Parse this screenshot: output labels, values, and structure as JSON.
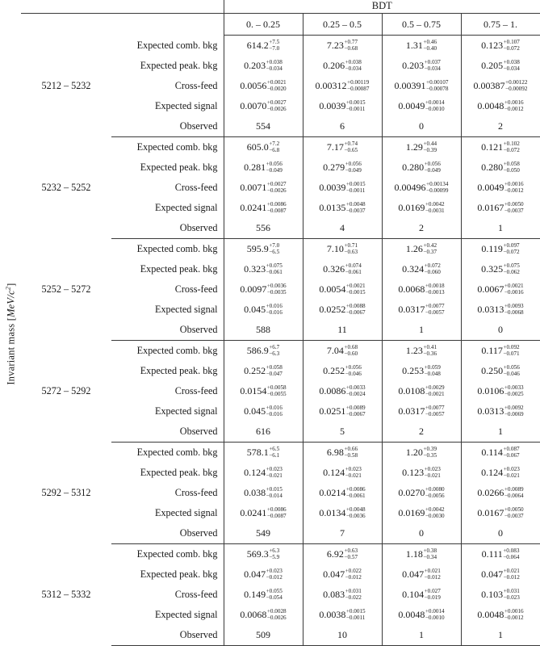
{
  "axis": {
    "ylabel_text": "Invariant mass",
    "ylabel_unit_open": "[",
    "ylabel_unit": "MeV/c",
    "ylabel_unit_sup": "2",
    "ylabel_unit_close": "]"
  },
  "header": {
    "group_label": "BDT",
    "bdt_bins": [
      "0. – 0.25",
      "0.25 – 0.5",
      "0.5 – 0.75",
      "0.75 – 1."
    ]
  },
  "row_labels": [
    "Expected comb. bkg",
    "Expected peak. bkg",
    "Cross-feed",
    "Expected signal",
    "Observed"
  ],
  "blocks": [
    {
      "bin": "5212 – 5232",
      "rows": [
        [
          {
            "v": "614.2",
            "up": "+7.5",
            "dn": "−7.0"
          },
          {
            "v": "7.23",
            "up": "+0.77",
            "dn": "−0.68"
          },
          {
            "v": "1.31",
            "up": "+0.46",
            "dn": "−0.40"
          },
          {
            "v": "0.123",
            "up": "+0.107",
            "dn": "−0.072"
          }
        ],
        [
          {
            "v": "0.203",
            "up": "+0.038",
            "dn": "−0.034"
          },
          {
            "v": "0.206",
            "up": "+0.038",
            "dn": "−0.034"
          },
          {
            "v": "0.203",
            "up": "+0.037",
            "dn": "−0.034"
          },
          {
            "v": "0.205",
            "up": "+0.038",
            "dn": "−0.034"
          }
        ],
        [
          {
            "v": "0.0056",
            "up": "+0.0021",
            "dn": "−0.0020"
          },
          {
            "v": "0.00312",
            "up": "+0.00119",
            "dn": "−0.00087"
          },
          {
            "v": "0.00391",
            "up": "+0.00107",
            "dn": "−0.00078"
          },
          {
            "v": "0.00387",
            "up": "+0.00122",
            "dn": "−0.00092"
          }
        ],
        [
          {
            "v": "0.0070",
            "up": "+0.0027",
            "dn": "−0.0026"
          },
          {
            "v": "0.0039",
            "up": "+0.0015",
            "dn": "−0.0011"
          },
          {
            "v": "0.0049",
            "up": "+0.0014",
            "dn": "−0.0010"
          },
          {
            "v": "0.0048",
            "up": "+0.0016",
            "dn": "−0.0012"
          }
        ],
        [
          {
            "v": "554",
            "up": "",
            "dn": ""
          },
          {
            "v": "6",
            "up": "",
            "dn": ""
          },
          {
            "v": "0",
            "up": "",
            "dn": ""
          },
          {
            "v": "2",
            "up": "",
            "dn": ""
          }
        ]
      ]
    },
    {
      "bin": "5232 – 5252",
      "rows": [
        [
          {
            "v": "605.0",
            "up": "+7.2",
            "dn": "−6.8"
          },
          {
            "v": "7.17",
            "up": "+0.74",
            "dn": "−0.65"
          },
          {
            "v": "1.29",
            "up": "+0.44",
            "dn": "−0.39"
          },
          {
            "v": "0.121",
            "up": "+0.102",
            "dn": "−0.072"
          }
        ],
        [
          {
            "v": "0.281",
            "up": "+0.056",
            "dn": "−0.049"
          },
          {
            "v": "0.279",
            "up": "+0.056",
            "dn": "−0.049"
          },
          {
            "v": "0.280",
            "up": "+0.056",
            "dn": "−0.049"
          },
          {
            "v": "0.280",
            "up": "+0.058",
            "dn": "−0.050"
          }
        ],
        [
          {
            "v": "0.0071",
            "up": "+0.0027",
            "dn": "−0.0026"
          },
          {
            "v": "0.0039",
            "up": "+0.0015",
            "dn": "−0.0011"
          },
          {
            "v": "0.00496",
            "up": "+0.00134",
            "dn": "−0.00099"
          },
          {
            "v": "0.0049",
            "up": "+0.0016",
            "dn": "−0.0012"
          }
        ],
        [
          {
            "v": "0.0241",
            "up": "+0.0086",
            "dn": "−0.0087"
          },
          {
            "v": "0.0135",
            "up": "+0.0048",
            "dn": "−0.0037"
          },
          {
            "v": "0.0169",
            "up": "+0.0042",
            "dn": "−0.0031"
          },
          {
            "v": "0.0167",
            "up": "+0.0050",
            "dn": "−0.0037"
          }
        ],
        [
          {
            "v": "556",
            "up": "",
            "dn": ""
          },
          {
            "v": "4",
            "up": "",
            "dn": ""
          },
          {
            "v": "2",
            "up": "",
            "dn": ""
          },
          {
            "v": "1",
            "up": "",
            "dn": ""
          }
        ]
      ]
    },
    {
      "bin": "5252 – 5272",
      "rows": [
        [
          {
            "v": "595.9",
            "up": "+7.0",
            "dn": "−6.5"
          },
          {
            "v": "7.10",
            "up": "+0.71",
            "dn": "−0.63"
          },
          {
            "v": "1.26",
            "up": "+0.42",
            "dn": "−0.37"
          },
          {
            "v": "0.119",
            "up": "+0.097",
            "dn": "−0.072"
          }
        ],
        [
          {
            "v": "0.323",
            "up": "+0.075",
            "dn": "−0.061"
          },
          {
            "v": "0.326",
            "up": "+0.074",
            "dn": "−0.061"
          },
          {
            "v": "0.324",
            "up": "+0.072",
            "dn": "−0.060"
          },
          {
            "v": "0.325",
            "up": "+0.075",
            "dn": "−0.062"
          }
        ],
        [
          {
            "v": "0.0097",
            "up": "+0.0036",
            "dn": "−0.0035"
          },
          {
            "v": "0.0054",
            "up": "+0.0021",
            "dn": "−0.0015"
          },
          {
            "v": "0.0068",
            "up": "+0.0018",
            "dn": "−0.0013"
          },
          {
            "v": "0.0067",
            "up": "+0.0021",
            "dn": "−0.0016"
          }
        ],
        [
          {
            "v": "0.045",
            "up": "+0.016",
            "dn": "−0.016"
          },
          {
            "v": "0.0252",
            "up": "+0.0088",
            "dn": "−0.0067"
          },
          {
            "v": "0.0317",
            "up": "+0.0077",
            "dn": "−0.0057"
          },
          {
            "v": "0.0313",
            "up": "+0.0093",
            "dn": "−0.0068"
          }
        ],
        [
          {
            "v": "588",
            "up": "",
            "dn": ""
          },
          {
            "v": "11",
            "up": "",
            "dn": ""
          },
          {
            "v": "1",
            "up": "",
            "dn": ""
          },
          {
            "v": "0",
            "up": "",
            "dn": ""
          }
        ]
      ]
    },
    {
      "bin": "5272 – 5292",
      "rows": [
        [
          {
            "v": "586.9",
            "up": "+6.7",
            "dn": "−6.3"
          },
          {
            "v": "7.04",
            "up": "+0.68",
            "dn": "−0.60"
          },
          {
            "v": "1.23",
            "up": "+0.41",
            "dn": "−0.36"
          },
          {
            "v": "0.117",
            "up": "+0.092",
            "dn": "−0.071"
          }
        ],
        [
          {
            "v": "0.252",
            "up": "+0.058",
            "dn": "−0.047"
          },
          {
            "v": "0.252",
            "up": "+0.056",
            "dn": "−0.046"
          },
          {
            "v": "0.253",
            "up": "+0.059",
            "dn": "−0.048"
          },
          {
            "v": "0.250",
            "up": "+0.056",
            "dn": "−0.046"
          }
        ],
        [
          {
            "v": "0.0154",
            "up": "+0.0058",
            "dn": "−0.0055"
          },
          {
            "v": "0.0086",
            "up": "+0.0033",
            "dn": "−0.0024"
          },
          {
            "v": "0.0108",
            "up": "+0.0029",
            "dn": "−0.0021"
          },
          {
            "v": "0.0106",
            "up": "+0.0033",
            "dn": "−0.0025"
          }
        ],
        [
          {
            "v": "0.045",
            "up": "+0.016",
            "dn": "−0.016"
          },
          {
            "v": "0.0251",
            "up": "+0.0089",
            "dn": "−0.0067"
          },
          {
            "v": "0.0317",
            "up": "+0.0077",
            "dn": "−0.0057"
          },
          {
            "v": "0.0313",
            "up": "+0.0092",
            "dn": "−0.0069"
          }
        ],
        [
          {
            "v": "616",
            "up": "",
            "dn": ""
          },
          {
            "v": "5",
            "up": "",
            "dn": ""
          },
          {
            "v": "2",
            "up": "",
            "dn": ""
          },
          {
            "v": "1",
            "up": "",
            "dn": ""
          }
        ]
      ]
    },
    {
      "bin": "5292 – 5312",
      "rows": [
        [
          {
            "v": "578.1",
            "up": "+6.5",
            "dn": "−6.1"
          },
          {
            "v": "6.98",
            "up": "+0.66",
            "dn": "−0.58"
          },
          {
            "v": "1.20",
            "up": "+0.39",
            "dn": "−0.35"
          },
          {
            "v": "0.114",
            "up": "+0.087",
            "dn": "−0.067"
          }
        ],
        [
          {
            "v": "0.124",
            "up": "+0.023",
            "dn": "−0.021"
          },
          {
            "v": "0.124",
            "up": "+0.023",
            "dn": "−0.021"
          },
          {
            "v": "0.123",
            "up": "+0.023",
            "dn": "−0.021"
          },
          {
            "v": "0.124",
            "up": "+0.023",
            "dn": "−0.021"
          }
        ],
        [
          {
            "v": "0.038",
            "up": "+0.015",
            "dn": "−0.014"
          },
          {
            "v": "0.0214",
            "up": "+0.0086",
            "dn": "−0.0061"
          },
          {
            "v": "0.0270",
            "up": "+0.0080",
            "dn": "−0.0056"
          },
          {
            "v": "0.0266",
            "up": "+0.0089",
            "dn": "−0.0064"
          }
        ],
        [
          {
            "v": "0.0241",
            "up": "+0.0086",
            "dn": "−0.0087"
          },
          {
            "v": "0.0134",
            "up": "+0.0048",
            "dn": "−0.0036"
          },
          {
            "v": "0.0169",
            "up": "+0.0042",
            "dn": "−0.0030"
          },
          {
            "v": "0.0167",
            "up": "+0.0050",
            "dn": "−0.0037"
          }
        ],
        [
          {
            "v": "549",
            "up": "",
            "dn": ""
          },
          {
            "v": "7",
            "up": "",
            "dn": ""
          },
          {
            "v": "0",
            "up": "",
            "dn": ""
          },
          {
            "v": "0",
            "up": "",
            "dn": ""
          }
        ]
      ]
    },
    {
      "bin": "5312 – 5332",
      "rows": [
        [
          {
            "v": "569.3",
            "up": "+6.3",
            "dn": "−5.9"
          },
          {
            "v": "6.92",
            "up": "+0.63",
            "dn": "−0.57"
          },
          {
            "v": "1.18",
            "up": "+0.38",
            "dn": "−0.34"
          },
          {
            "v": "0.111",
            "up": "+0.083",
            "dn": "−0.064"
          }
        ],
        [
          {
            "v": "0.047",
            "up": "+0.023",
            "dn": "−0.012"
          },
          {
            "v": "0.047",
            "up": "+0.022",
            "dn": "−0.012"
          },
          {
            "v": "0.047",
            "up": "+0.021",
            "dn": "−0.012"
          },
          {
            "v": "0.047",
            "up": "+0.021",
            "dn": "−0.012"
          }
        ],
        [
          {
            "v": "0.149",
            "up": "+0.055",
            "dn": "−0.054"
          },
          {
            "v": "0.083",
            "up": "+0.031",
            "dn": "−0.022"
          },
          {
            "v": "0.104",
            "up": "+0.027",
            "dn": "−0.019"
          },
          {
            "v": "0.103",
            "up": "+0.031",
            "dn": "−0.023"
          }
        ],
        [
          {
            "v": "0.0068",
            "up": "+0.0028",
            "dn": "−0.0026"
          },
          {
            "v": "0.0038",
            "up": "+0.0015",
            "dn": "−0.0011"
          },
          {
            "v": "0.0048",
            "up": "+0.0014",
            "dn": "−0.0010"
          },
          {
            "v": "0.0048",
            "up": "+0.0016",
            "dn": "−0.0012"
          }
        ],
        [
          {
            "v": "509",
            "up": "",
            "dn": ""
          },
          {
            "v": "10",
            "up": "",
            "dn": ""
          },
          {
            "v": "1",
            "up": "",
            "dn": ""
          },
          {
            "v": "1",
            "up": "",
            "dn": ""
          }
        ]
      ]
    }
  ]
}
